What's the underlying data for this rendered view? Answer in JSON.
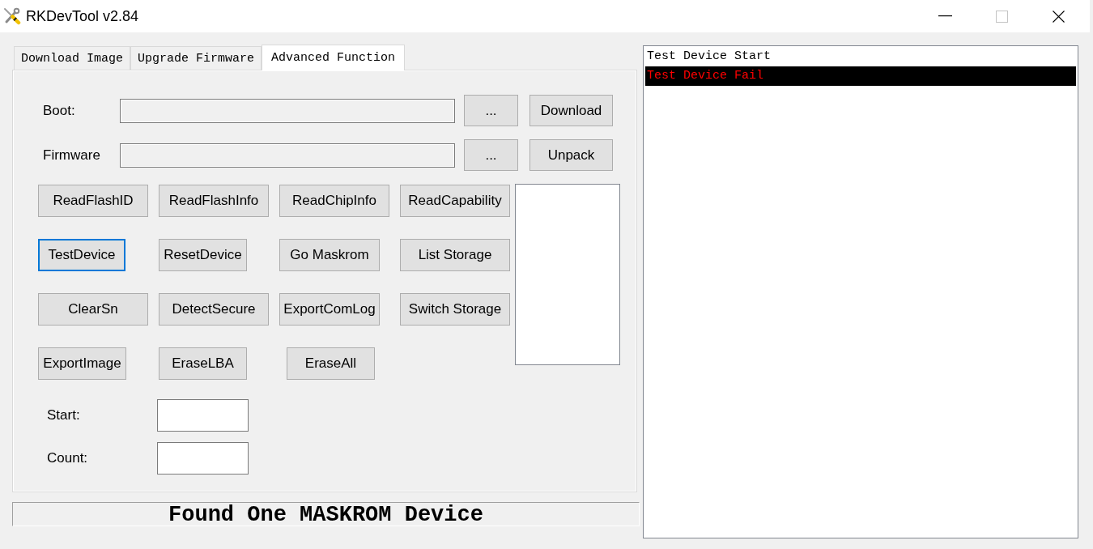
{
  "window": {
    "title": "RKDevTool v2.84",
    "controls": [
      {
        "kind": "minimize",
        "disabled": false
      },
      {
        "kind": "maximize",
        "disabled": true
      },
      {
        "kind": "close",
        "disabled": false
      }
    ]
  },
  "tabs": [
    {
      "label": "Download Image",
      "selected": false
    },
    {
      "label": "Upgrade Firmware",
      "selected": false
    },
    {
      "label": "Advanced Function",
      "selected": true
    }
  ],
  "file_rows": [
    {
      "label": "Boot:",
      "browse": "...",
      "action": "Download"
    },
    {
      "label": "Firmware",
      "browse": "...",
      "action": "Unpack"
    }
  ],
  "function_buttons": [
    {
      "label": "ReadFlashID",
      "focused": false
    },
    {
      "label": "ReadFlashInfo",
      "focused": false
    },
    {
      "label": "ReadChipInfo",
      "focused": false
    },
    {
      "label": "ReadCapability",
      "focused": false
    },
    {
      "label": "TestDevice",
      "focused": true
    },
    {
      "label": "ResetDevice",
      "focused": false
    },
    {
      "label": "Go Maskrom",
      "focused": false
    },
    {
      "label": "List Storage",
      "focused": false
    },
    {
      "label": "ClearSn",
      "focused": false
    },
    {
      "label": "DetectSecure",
      "focused": false
    },
    {
      "label": "ExportComLog",
      "focused": false
    },
    {
      "label": "Switch Storage",
      "focused": false
    },
    {
      "label": "ExportImage",
      "focused": false
    },
    {
      "label": "EraseLBA",
      "focused": false
    },
    {
      "label": "EraseAll",
      "focused": false
    }
  ],
  "range_fields": [
    {
      "label": "Start:"
    },
    {
      "label": "Count:"
    }
  ],
  "status_bar": {
    "text": "Found One MASKROM Device"
  },
  "log": {
    "lines": [
      {
        "text": "Test Device Start",
        "kind": "info"
      },
      {
        "text": "Test Device Fail",
        "kind": "error"
      }
    ]
  }
}
